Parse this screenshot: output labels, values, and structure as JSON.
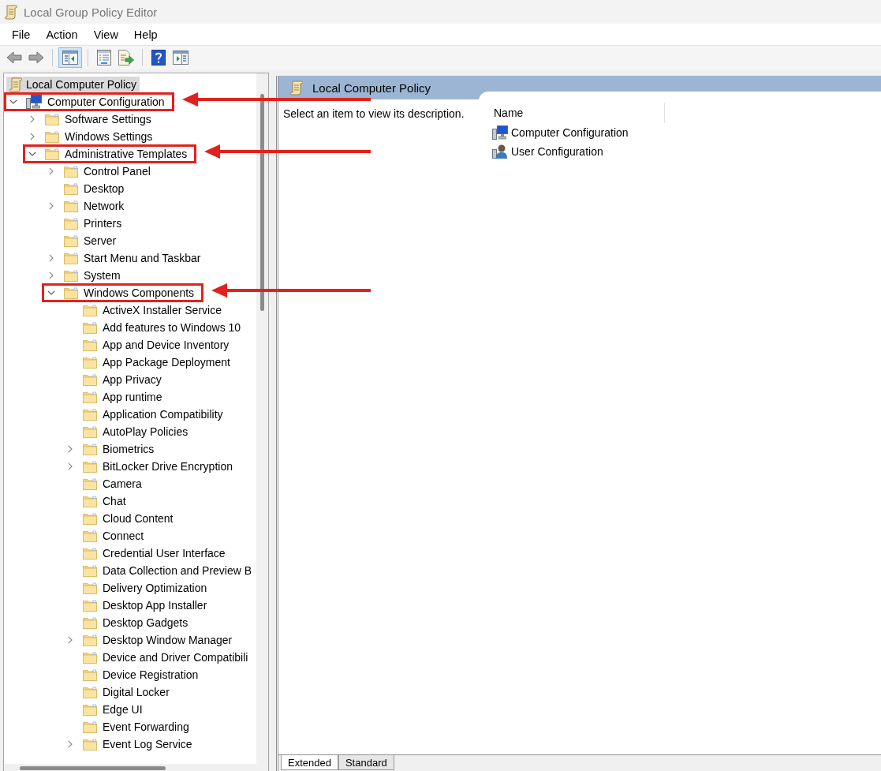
{
  "window": {
    "title": "Local Group Policy Editor"
  },
  "menu_bar": [
    {
      "label": "File"
    },
    {
      "label": "Action"
    },
    {
      "label": "View"
    },
    {
      "label": "Help"
    }
  ],
  "toolbar": {
    "groups": [
      [
        {
          "kind": "back",
          "pressed": false
        },
        {
          "kind": "forward",
          "pressed": false
        }
      ],
      [
        {
          "kind": "console_tree",
          "pressed": true
        }
      ],
      [
        {
          "kind": "properties",
          "pressed": false
        },
        {
          "kind": "export_list",
          "pressed": false
        }
      ],
      [
        {
          "kind": "help",
          "pressed": false
        },
        {
          "kind": "action_pane",
          "pressed": false
        }
      ]
    ]
  },
  "tree": {
    "items": [
      {
        "kind": "policy",
        "label": "Local Computer Policy",
        "selected": true,
        "annotated": false,
        "expanded": true,
        "children": [
          {
            "kind": "computer",
            "label": "Computer Configuration",
            "selected": false,
            "annotated": true,
            "expanded": true,
            "children": [
              {
                "kind": "folder",
                "label": "Software Settings",
                "selected": false,
                "annotated": false,
                "expanded": false
              },
              {
                "kind": "folder",
                "label": "Windows Settings",
                "selected": false,
                "annotated": false,
                "expanded": false
              },
              {
                "kind": "folder",
                "label": "Administrative Templates",
                "selected": false,
                "annotated": true,
                "expanded": true,
                "children": [
                  {
                    "kind": "folder",
                    "label": "Control Panel",
                    "selected": false,
                    "annotated": false,
                    "expanded": false
                  },
                  {
                    "kind": "folder",
                    "label": "Desktop",
                    "selected": false,
                    "annotated": false
                  },
                  {
                    "kind": "folder",
                    "label": "Network",
                    "selected": false,
                    "annotated": false,
                    "expanded": false
                  },
                  {
                    "kind": "folder",
                    "label": "Printers",
                    "selected": false,
                    "annotated": false
                  },
                  {
                    "kind": "folder",
                    "label": "Server",
                    "selected": false,
                    "annotated": false
                  },
                  {
                    "kind": "folder",
                    "label": "Start Menu and Taskbar",
                    "selected": false,
                    "annotated": false,
                    "expanded": false
                  },
                  {
                    "kind": "folder",
                    "label": "System",
                    "selected": false,
                    "annotated": false,
                    "expanded": false
                  },
                  {
                    "kind": "folder",
                    "label": "Windows Components",
                    "selected": false,
                    "annotated": true,
                    "expanded": true,
                    "children": [
                      {
                        "kind": "folder",
                        "label": "ActiveX Installer Service",
                        "selected": false,
                        "annotated": false
                      },
                      {
                        "kind": "folder",
                        "label": "Add features to Windows 10",
                        "selected": false,
                        "annotated": false
                      },
                      {
                        "kind": "folder",
                        "label": "App and Device Inventory",
                        "selected": false,
                        "annotated": false
                      },
                      {
                        "kind": "folder",
                        "label": "App Package Deployment",
                        "selected": false,
                        "annotated": false
                      },
                      {
                        "kind": "folder",
                        "label": "App Privacy",
                        "selected": false,
                        "annotated": false
                      },
                      {
                        "kind": "folder",
                        "label": "App runtime",
                        "selected": false,
                        "annotated": false
                      },
                      {
                        "kind": "folder",
                        "label": "Application Compatibility",
                        "selected": false,
                        "annotated": false
                      },
                      {
                        "kind": "folder",
                        "label": "AutoPlay Policies",
                        "selected": false,
                        "annotated": false
                      },
                      {
                        "kind": "folder",
                        "label": "Biometrics",
                        "selected": false,
                        "annotated": false,
                        "expanded": false
                      },
                      {
                        "kind": "folder",
                        "label": "BitLocker Drive Encryption",
                        "selected": false,
                        "annotated": false,
                        "expanded": false
                      },
                      {
                        "kind": "folder",
                        "label": "Camera",
                        "selected": false,
                        "annotated": false
                      },
                      {
                        "kind": "folder",
                        "label": "Chat",
                        "selected": false,
                        "annotated": false
                      },
                      {
                        "kind": "folder",
                        "label": "Cloud Content",
                        "selected": false,
                        "annotated": false
                      },
                      {
                        "kind": "folder",
                        "label": "Connect",
                        "selected": false,
                        "annotated": false
                      },
                      {
                        "kind": "folder",
                        "label": "Credential User Interface",
                        "selected": false,
                        "annotated": false
                      },
                      {
                        "kind": "folder",
                        "label": "Data Collection and Preview B",
                        "selected": false,
                        "annotated": false
                      },
                      {
                        "kind": "folder",
                        "label": "Delivery Optimization",
                        "selected": false,
                        "annotated": false
                      },
                      {
                        "kind": "folder",
                        "label": "Desktop App Installer",
                        "selected": false,
                        "annotated": false
                      },
                      {
                        "kind": "folder",
                        "label": "Desktop Gadgets",
                        "selected": false,
                        "annotated": false
                      },
                      {
                        "kind": "folder",
                        "label": "Desktop Window Manager",
                        "selected": false,
                        "annotated": false,
                        "expanded": false
                      },
                      {
                        "kind": "folder",
                        "label": "Device and Driver Compatibili",
                        "selected": false,
                        "annotated": false
                      },
                      {
                        "kind": "folder",
                        "label": "Device Registration",
                        "selected": false,
                        "annotated": false
                      },
                      {
                        "kind": "folder",
                        "label": "Digital Locker",
                        "selected": false,
                        "annotated": false
                      },
                      {
                        "kind": "folder",
                        "label": "Edge UI",
                        "selected": false,
                        "annotated": false
                      },
                      {
                        "kind": "folder",
                        "label": "Event Forwarding",
                        "selected": false,
                        "annotated": false
                      },
                      {
                        "kind": "folder",
                        "label": "Event Log Service",
                        "selected": false,
                        "annotated": false,
                        "expanded": false
                      }
                    ]
                  }
                ]
              }
            ]
          }
        ]
      }
    ]
  },
  "details": {
    "title": "Local Computer Policy",
    "description": "Select an item to view its description.",
    "columns": [
      {
        "label": "Name"
      }
    ],
    "rows": [
      {
        "kind": "computer",
        "name": "Computer Configuration",
        "selected": false
      },
      {
        "kind": "user",
        "name": "User Configuration",
        "selected": false
      }
    ],
    "view_tabs": [
      {
        "label": "Extended",
        "selected": true
      },
      {
        "label": "Standard",
        "selected": false
      }
    ]
  }
}
